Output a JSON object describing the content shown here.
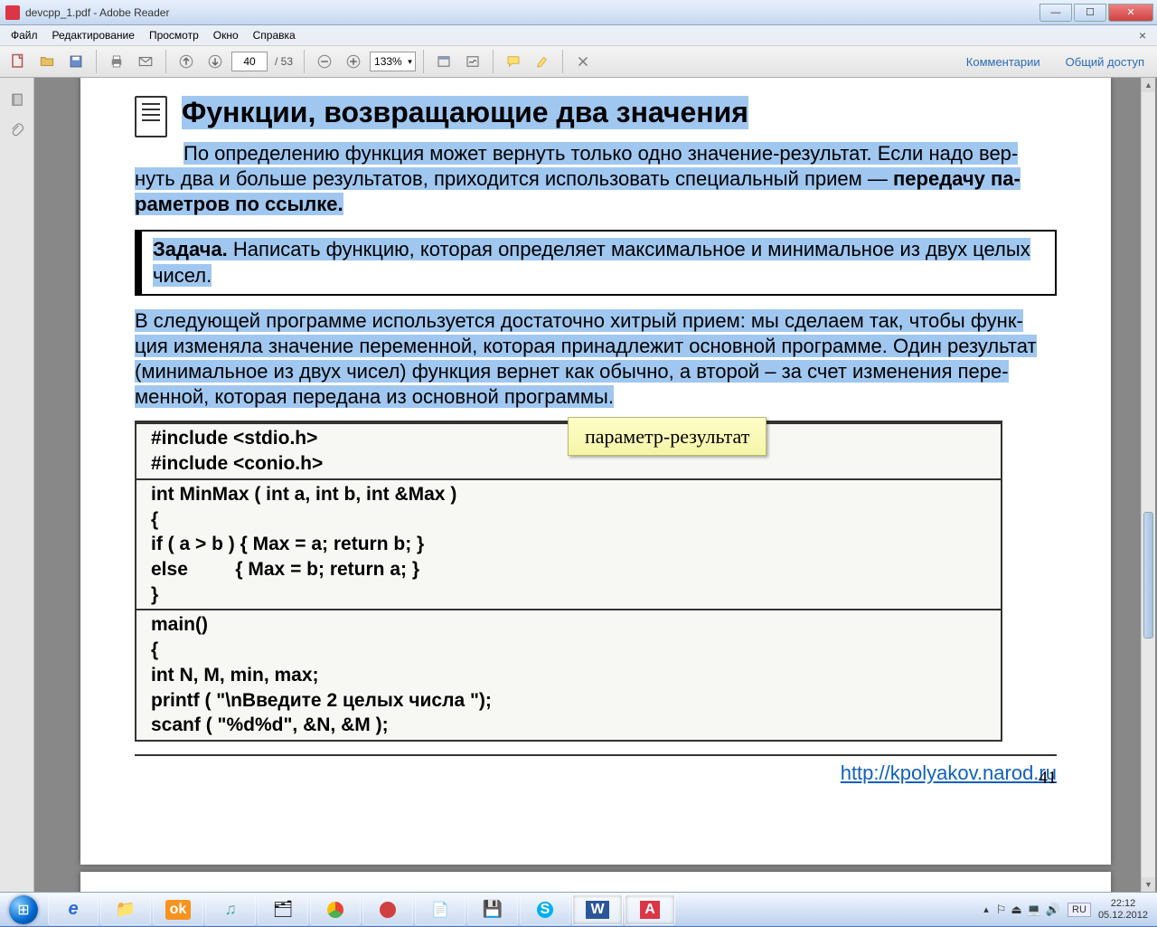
{
  "window": {
    "title": "devcpp_1.pdf - Adobe Reader"
  },
  "menu": {
    "file": "Файл",
    "edit": "Редактирование",
    "view": "Просмотр",
    "window": "Окно",
    "help": "Справка"
  },
  "toolbar": {
    "page_current": "40",
    "page_total": "/ 53",
    "zoom": "133%",
    "comments": "Комментарии",
    "share": "Общий доступ"
  },
  "doc": {
    "heading": "Функции, возвращающие два значения",
    "para1_a": "По определению функция может вернуть только одно значение-результат. Если надо вер-",
    "para1_b": "нуть два и больше результатов, приходится использовать специальный прием — ",
    "para1_bold": "передачу па-",
    "para1_c": "раметров по ссылке.",
    "task_label": "Задача.",
    "task_text_a": " Написать функцию, которая определяет максимальное и минимальное из двух целых",
    "task_text_b": "чисел.",
    "para2_a": "В следующей программе используется достаточно хитрый прием: мы сделаем так, чтобы функ-",
    "para2_b": "ция изменяла значение переменной, которая принадлежит основной программе. Один результат",
    "para2_c": "(минимальное из двух чисел) функция вернет как обычно, а второй – за счет изменения пере-",
    "para2_d": "менной, которая передана из основной программы.",
    "callout": "параметр-результат",
    "code": {
      "r1l1": "#include <stdio.h>",
      "r1l2": "#include <conio.h>",
      "r2l1": "int MinMax ( int a, int b, int &Max )",
      "r2l2": "{",
      "r2l3": "if ( a > b ) { Max = a; return b; }",
      "r2l4": "else         { Max = b; return a; }",
      "r2l5": "}",
      "r3l1": "main()",
      "r3l2": "{",
      "r3l3": "int N, M, min, max;",
      "r3l4": "printf ( \"\\nВведите 2 целых числа \");",
      "r3l5": "scanf ( \"%d%d\", &N, &M );"
    },
    "footer_link": "http://kpolyakov.narod.ru",
    "page_num": "41"
  },
  "tray": {
    "lang": "RU",
    "time": "22:12",
    "date": "05.12.2012"
  }
}
